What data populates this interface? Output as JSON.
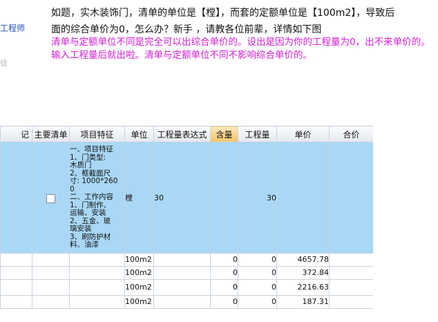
{
  "sidebar": {
    "role": "工程师",
    "sub": "徒"
  },
  "question": {
    "line1": "如题，实木装饰门，清单的单位是【樘】，而套的定额单位是【100m2】，导致后",
    "line2": "面的综合单价为0，怎么办？新手 ，请教各位前辈，详情如下图"
  },
  "answer": "清单与定额单位不同是完全可以出综合单价的。设出是因为你的工程量为0，出不来单价的。输入工程量后就出啦。清单与定额单位不同不影响综合单价的。",
  "grid": {
    "headers": [
      "记",
      "主要清单",
      "项目特征",
      "单位",
      "工程量表达式",
      "含量",
      "工程量",
      "单价",
      "合价"
    ],
    "main_row": {
      "feature_lines": [
        "一、项目特征",
        "1、门类型:",
        "木质门",
        "2、框截面尺",
        "寸: 1000*260",
        "0",
        "二、工作内容",
        "1、门制作、",
        "运输、安装",
        "2、五金、玻",
        "璃安装",
        "3、刷防护材",
        "料、油漆"
      ],
      "unit": "樘",
      "expr": "30",
      "quantity": "30"
    },
    "sub_rows": [
      {
        "unit": "100m2",
        "content": "0",
        "quantity": "0",
        "price": "4657.78"
      },
      {
        "unit": "100m2",
        "content": "0",
        "quantity": "0",
        "price": "372.84"
      },
      {
        "unit": "100m2",
        "content": "0",
        "quantity": "0",
        "price": "2216.63"
      },
      {
        "unit": "100m2",
        "content": "0",
        "quantity": "0",
        "price": "187.31"
      }
    ]
  }
}
